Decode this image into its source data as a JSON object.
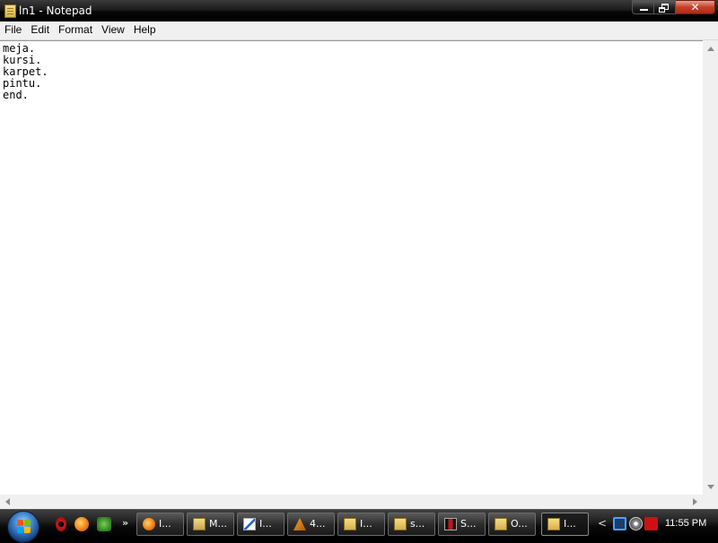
{
  "window": {
    "title": "ln1 - Notepad",
    "controls": {
      "minimize": "minimize",
      "maximize": "restore",
      "close": "✕"
    }
  },
  "menu": [
    "File",
    "Edit",
    "Format",
    "View",
    "Help"
  ],
  "editor": {
    "content": "meja.\nkursi.\nkarpet.\npintu.\nend."
  },
  "taskbar": {
    "quick_launch": [
      "opera-icon",
      "firefox-icon",
      "download-icon"
    ],
    "buttons": [
      {
        "label": "I...",
        "icon": "firefox-icon"
      },
      {
        "label": "M...",
        "icon": "folder-icon"
      },
      {
        "label": "I...",
        "icon": "paint-icon"
      },
      {
        "label": "4...",
        "icon": "winamp-icon"
      },
      {
        "label": "I...",
        "icon": "notepad-icon"
      },
      {
        "label": "s...",
        "icon": "notepad-icon"
      },
      {
        "label": "S...",
        "icon": "app-icon"
      },
      {
        "label": "O...",
        "icon": "notepad-icon"
      },
      {
        "label": "I...",
        "icon": "notepad-icon",
        "active": true
      }
    ],
    "tray_icons": [
      "network-icon",
      "security-icon",
      "antivirus-icon"
    ],
    "clock": "11:55 PM"
  },
  "colors": {
    "title_bar": "#000000",
    "close_button": "#c5402a",
    "editor_background": "#ffffff",
    "taskbar": "#0a0a0a"
  }
}
